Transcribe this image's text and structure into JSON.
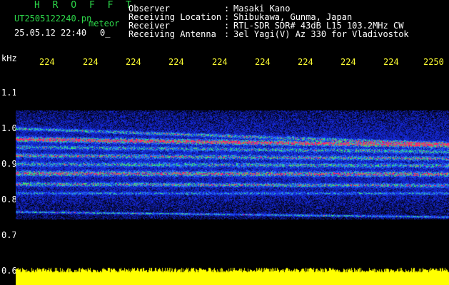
{
  "brand": {
    "name": "H R O F F T",
    "file_ut": "UT2505122240.pn",
    "file_suffix": "meteor",
    "datetime": "25.05.12 22:40",
    "extra": "0_"
  },
  "info": {
    "rows": [
      {
        "label": "Observer",
        "sep": ":",
        "value": "Masaki Kano"
      },
      {
        "label": "Receiving Location",
        "sep": ":",
        "value": "Shibukawa, Gunma, Japan"
      },
      {
        "label": "Receiver",
        "sep": ":",
        "value": "RTL-SDR SDR# 43dB L15 103.2MHz CW"
      },
      {
        "label": "Receiving Antenna",
        "sep": ":",
        "value": "3el Yagi(V) Az 330 for Vladivostok"
      }
    ]
  },
  "axes": {
    "y_unit": "kHz",
    "y_ticks": [
      "1.1",
      "1.0",
      "0.9",
      "0.8",
      "0.7",
      "0.6"
    ],
    "x_ticks": [
      "224",
      "224",
      "224",
      "224",
      "224",
      "224",
      "224",
      "224",
      "224",
      "2250"
    ]
  },
  "colors": {
    "title_green": "#2dd94a",
    "tick_yellow": "#ffff33",
    "trace_red": "#ff2060",
    "noise_blue": "#1830d0",
    "amplitude_yellow": "#ffff00"
  }
}
